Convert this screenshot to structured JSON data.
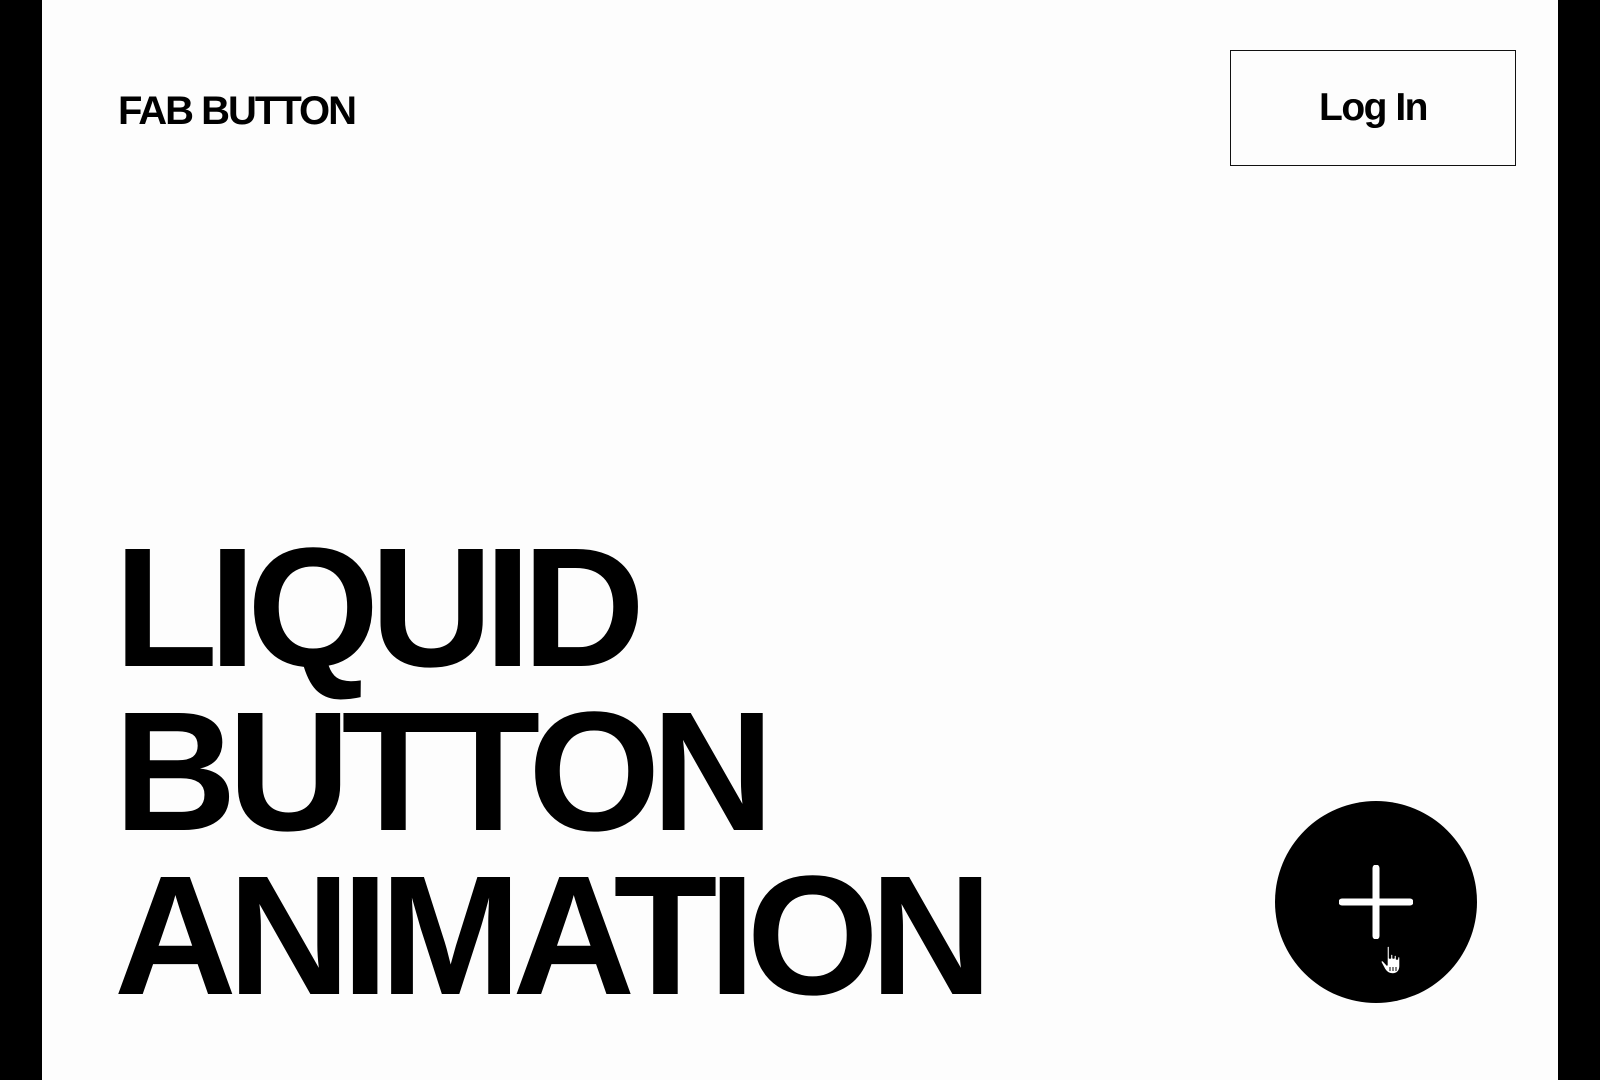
{
  "header": {
    "brand": "FAB BUTTON",
    "login_label": "Log In"
  },
  "hero": {
    "lines": [
      "LIQUID",
      "BUTTON",
      "ANIMATION"
    ]
  },
  "fab": {
    "icon": "plus-icon"
  },
  "cursor": {
    "icon": "hand-pointer-icon"
  },
  "colors": {
    "background": "#fdfdfd",
    "frame_border": "#000000",
    "text": "#000000",
    "fab": "#000000",
    "fab_icon": "#ffffff"
  }
}
